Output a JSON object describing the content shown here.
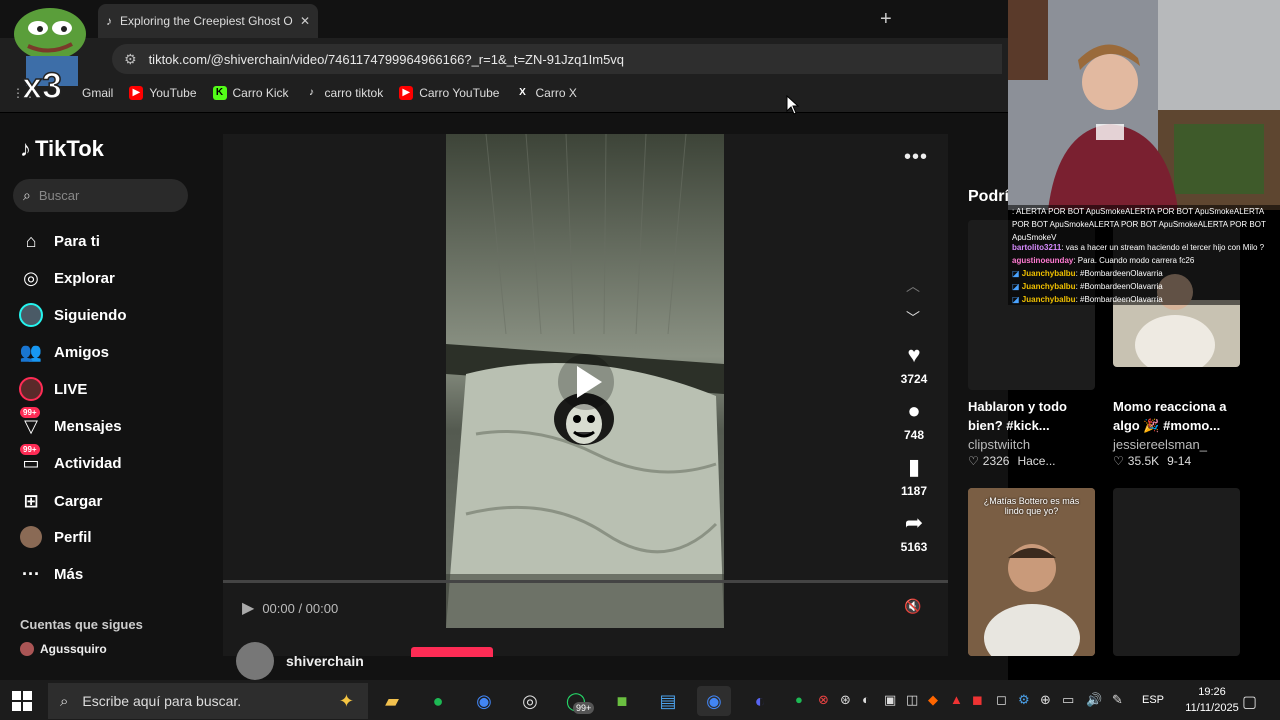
{
  "browser": {
    "tab_title": "Exploring the Creepiest Ghost O",
    "url": "tiktok.com/@shiverchain/video/7461174799964966166?_r=1&_t=ZN-91Jzq1Im5vq",
    "bookmarks": [
      "Gmail",
      "YouTube",
      "Carro Kick",
      "carro tiktok",
      "Carro YouTube",
      "Carro X"
    ]
  },
  "overlay": {
    "pepe_badge": "x3"
  },
  "tiktok": {
    "logo": "TikTok",
    "search_placeholder": "Buscar",
    "nav": [
      {
        "label": "Para ti",
        "icon": "home-icon"
      },
      {
        "label": "Explorar",
        "icon": "compass-icon"
      },
      {
        "label": "Siguiendo",
        "icon": "following-avatar-icon"
      },
      {
        "label": "Amigos",
        "icon": "friends-icon"
      },
      {
        "label": "LIVE",
        "icon": "live-icon"
      },
      {
        "label": "Mensajes",
        "icon": "messages-icon",
        "badge": "99+"
      },
      {
        "label": "Actividad",
        "icon": "activity-icon",
        "badge": "99+"
      },
      {
        "label": "Cargar",
        "icon": "upload-icon"
      },
      {
        "label": "Perfil",
        "icon": "profile-avatar-icon"
      },
      {
        "label": "Más",
        "icon": "more-dots-icon"
      }
    ],
    "following_title": "Cuentas que sigues",
    "following_account": "Agussquiro",
    "player": {
      "likes": "3724",
      "comments": "748",
      "saves": "1187",
      "shares": "5163",
      "time": "00:00 / 00:00",
      "author": "shiverchain",
      "progress": 0
    },
    "recommend_title": "Podrí",
    "cards": [
      {
        "title": "Hablaron y todo bien? #kick...",
        "author": "clipstwiitch",
        "likes": "2326",
        "date": "Hace..."
      },
      {
        "title": "Momo reacciona a algo 🎉 #momo...",
        "author": "jessiereelsman_",
        "likes": "35.5K",
        "date": "9-14"
      },
      {
        "overlay_text": "¿Matías Bottero es más lindo que yo?"
      }
    ]
  },
  "chat": [
    {
      "user": "",
      "text": ": ALERTA POR BOT ApuSmokeALERTA POR BOT ApuSmokeALERTA POR BOT ApuSmokeALERTA POR BOT ApuSmokeALERTA POR BOT ApuSmokeV",
      "color": "#e05050"
    },
    {
      "user": "bartolito3211",
      "text": ": vas a hacer un stream haciendo el tercer hijo con Milo ?",
      "color": "#d88cff"
    },
    {
      "user": "agustinoeunday",
      "text": ": Para. Cuando modo carrera fc26",
      "color": "#ff7ad1"
    },
    {
      "user": "Juanchybalbu",
      "text": ": #BombardeenOlavarria",
      "color": "#f0c000"
    },
    {
      "user": "Juanchybalbu",
      "text": ": #BombardeenOlavarria",
      "color": "#f0c000"
    },
    {
      "user": "Juanchybalbu",
      "text": ": #BombardeenOlavarria",
      "color": "#f0c000"
    }
  ],
  "taskbar": {
    "search_placeholder": "Escribe aquí para buscar.",
    "whatsapp_badge": "99+",
    "lang": "ESP",
    "time": "19:26",
    "date": "11/11/2025"
  },
  "colors": {
    "accent": "#fe2c55",
    "page_bg": "#121212"
  }
}
